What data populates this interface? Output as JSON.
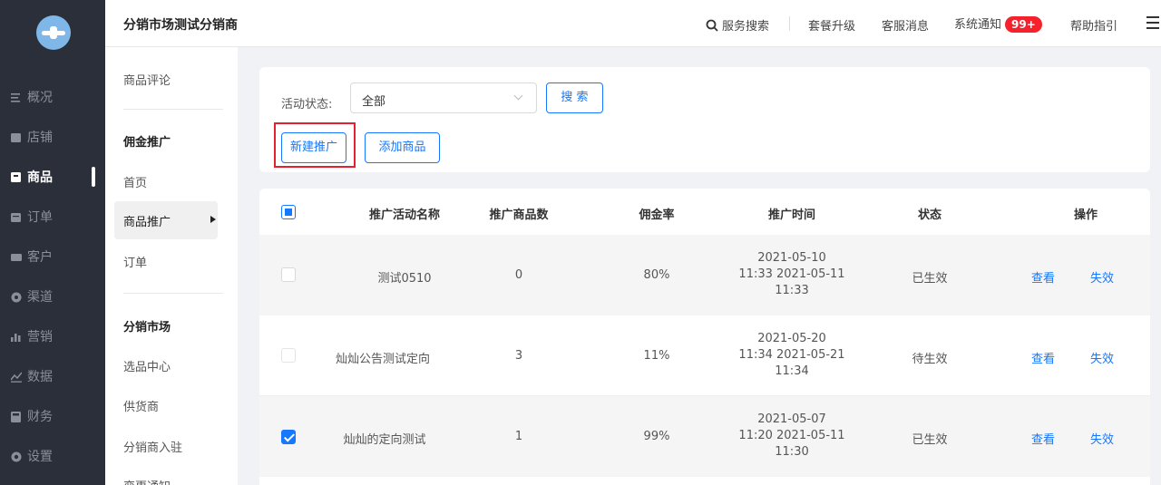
{
  "sidebar": {
    "items": [
      {
        "label": "概况",
        "icon": "menu-lines-icon"
      },
      {
        "label": "店铺",
        "icon": "store-icon"
      },
      {
        "label": "商品",
        "icon": "goods-icon",
        "active": true
      },
      {
        "label": "订单",
        "icon": "order-icon"
      },
      {
        "label": "客户",
        "icon": "vip-card-icon"
      },
      {
        "label": "渠道",
        "icon": "channel-icon"
      },
      {
        "label": "营销",
        "icon": "bar-chart-icon"
      },
      {
        "label": "数据",
        "icon": "line-chart-icon"
      },
      {
        "label": "财务",
        "icon": "calculator-icon"
      },
      {
        "label": "设置",
        "icon": "gear-icon"
      }
    ]
  },
  "header": {
    "shop_name": "分销市场测试分销商",
    "search": "服务搜索",
    "upgrade": "套餐升级",
    "service_msg": "客服消息",
    "notify": "系统通知",
    "notify_badge": "99+",
    "help": "帮助指引"
  },
  "subnav": {
    "review": "商品评论",
    "group1": "佣金推广",
    "home": "首页",
    "promo": "商品推广",
    "order": "订单",
    "group2": "分销市场",
    "select_center": "选品中心",
    "supplier": "供货商",
    "join": "分销商入驻",
    "change": "变更通知"
  },
  "filter": {
    "status_label": "活动状态:",
    "status_value": "全部",
    "search_btn": "搜 索",
    "new_btn": "新建推广",
    "add_btn": "添加商品"
  },
  "table": {
    "headers": [
      "推广活动名称",
      "推广商品数",
      "佣金率",
      "推广时间",
      "状态",
      "操作"
    ],
    "rows": [
      {
        "name": "测试0510",
        "count": "0",
        "rate": "80%",
        "time1": "2021-05-10",
        "time2": "11:33 2021-05-11",
        "time3": "11:33",
        "status": "已生效",
        "view": "查看",
        "disable": "失效",
        "checked": false
      },
      {
        "name": "灿灿公告测试定向",
        "count": "3",
        "rate": "11%",
        "time1": "2021-05-20",
        "time2": "11:34 2021-05-21",
        "time3": "11:34",
        "status": "待生效",
        "view": "查看",
        "disable": "失效",
        "checked": false
      },
      {
        "name": "灿灿的定向测试",
        "count": "1",
        "rate": "99%",
        "time1": "2021-05-07",
        "time2": "11:20 2021-05-11",
        "time3": "11:30",
        "status": "已生效",
        "view": "查看",
        "disable": "失效",
        "checked": true
      }
    ]
  },
  "colors": {
    "accent": "#1677ff",
    "sidebar_bg": "#2b2f3a",
    "highlight": "#e5202e",
    "badge": "#f5222d"
  }
}
